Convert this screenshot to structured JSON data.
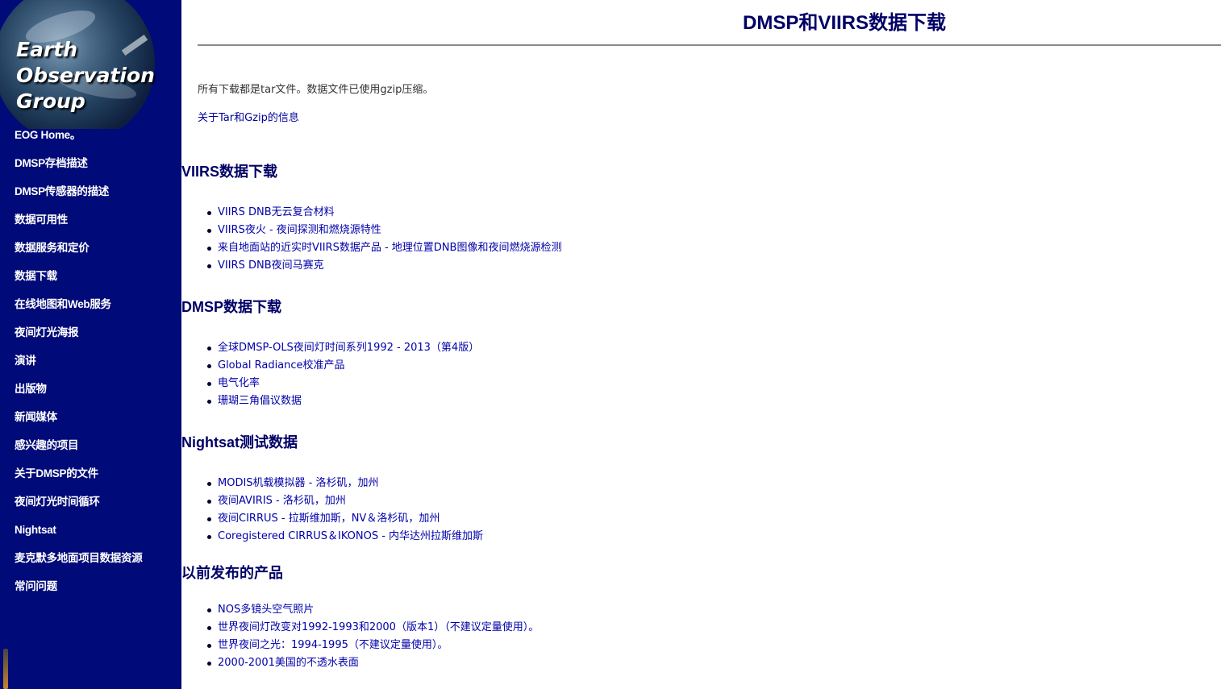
{
  "logo": {
    "lines": [
      "Earth",
      "Observation",
      "Group"
    ]
  },
  "nav": [
    "EOG Home。",
    "DMSP存档描述",
    "DMSP传感器的描述",
    "数据可用性",
    "数据服务和定价",
    "数据下载",
    "在线地图和Web服务",
    "夜间灯光海报",
    "演讲",
    "出版物",
    "新闻媒体",
    "感兴趣的项目",
    "关于DMSP的文件",
    "夜间灯光时间循环",
    "Nightsat",
    "麦克默多地面项目数据资源",
    "常问问题"
  ],
  "page": {
    "title": "DMSP和VIIRS数据下载",
    "intro": "所有下载都是tar文件。数据文件已使用gzip压缩。",
    "tar_info_link": "关于Tar和Gzip的信息"
  },
  "sections": [
    {
      "title": "VIIRS数据下载",
      "links": [
        "VIIRS DNB无云复合材料",
        "VIIRS夜火 - 夜间探测和燃烧源特性",
        "来自地面站的近实时VIIRS数据产品 - 地理位置DNB图像和夜间燃烧源检测",
        "VIIRS DNB夜间马赛克"
      ]
    },
    {
      "title": "DMSP数据下载",
      "links": [
        "全球DMSP-OLS夜间灯时间系列1992 - 2013（第4版）",
        "Global Radiance校准产品",
        "电气化率",
        "珊瑚三角倡议数据"
      ]
    },
    {
      "title": "Nightsat测试数据",
      "links": [
        "MODIS机载模拟器 - 洛杉矶，加州",
        "夜间AVIRIS - 洛杉矶，加州",
        "夜间CIRRUS - 拉斯维加斯，NV＆洛杉矶，加州",
        "Coregistered CIRRUS＆IKONOS - 内华达州拉斯维加斯"
      ]
    },
    {
      "title": "以前发布的产品",
      "links": [
        "NOS多镜头空气照片",
        "世界夜间灯改变对1992-1993和2000（版本1）（不建议定量使用）。",
        "世界夜间之光：1994-1995（不建议定量使用）。",
        "2000-2001美国的不透水表面"
      ]
    }
  ]
}
